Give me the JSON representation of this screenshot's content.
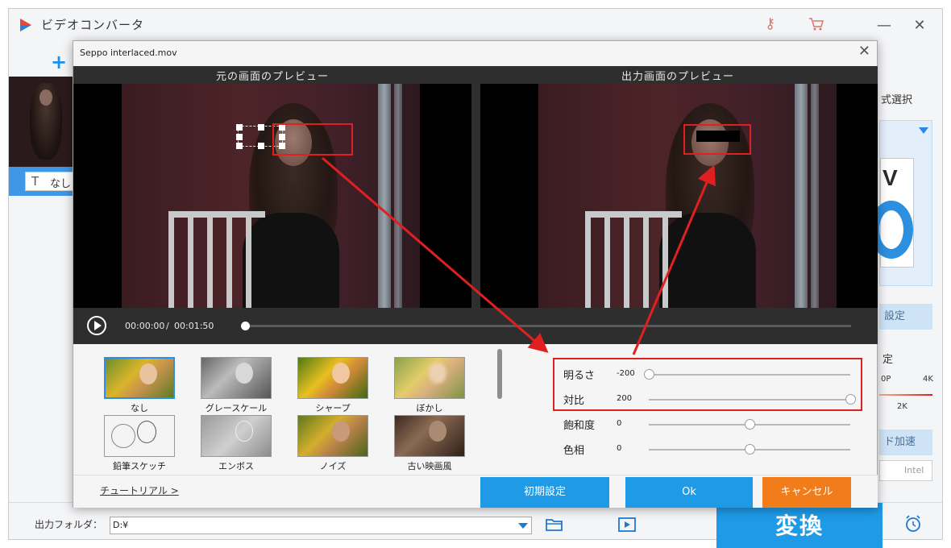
{
  "app": {
    "title": "ビデオコンバータ",
    "close_glyph": "✕",
    "minimize_glyph": "—",
    "key_icon": "key-icon",
    "cart_icon": "cart-icon"
  },
  "left_panel": {
    "add_symbol": "+",
    "subtitle_value": "なし",
    "subtitle_icon_glyph": "T"
  },
  "right_strip": {
    "format_label": "式選択",
    "settings_label": "設定",
    "quality_label": "定",
    "quality_ticks": [
      "0P",
      "4K",
      "2K"
    ],
    "hw_accel_label": "ド加速",
    "intel_label": "Intel"
  },
  "bottom": {
    "output_folder_label": "出力フォルダ：",
    "output_folder_value": "D:¥",
    "convert_label": "変換"
  },
  "dialog": {
    "title": "Seppo interlaced.mov",
    "close_glyph": "✕",
    "original_preview_label": "元の画面のプレビュー",
    "output_preview_label": "出力画面のプレビュー",
    "current_time": "00:00:00",
    "time_separator": "/",
    "total_time": "00:01:50",
    "playback_progress": 0.0,
    "filters": [
      {
        "label": "なし",
        "selected": true
      },
      {
        "label": "グレースケール",
        "selected": false
      },
      {
        "label": "シャープ",
        "selected": false
      },
      {
        "label": "ぼかし",
        "selected": false
      },
      {
        "label": "鉛筆スケッチ",
        "selected": false
      },
      {
        "label": "エンボス",
        "selected": false
      },
      {
        "label": "ノイズ",
        "selected": false
      },
      {
        "label": "古い映画風",
        "selected": false
      }
    ],
    "adjustments": [
      {
        "label": "明るさ",
        "value": "-200",
        "min": -200,
        "max": 200,
        "current": -200
      },
      {
        "label": "対比",
        "value": "200",
        "min": -200,
        "max": 200,
        "current": 200
      },
      {
        "label": "飽和度",
        "value": "0",
        "min": -200,
        "max": 200,
        "current": 0
      },
      {
        "label": "色相",
        "value": "0",
        "min": -200,
        "max": 200,
        "current": 0
      }
    ],
    "tutorial_link": "チュートリアル >",
    "reset_button": "初期設定",
    "ok_button": "Ok",
    "cancel_button": "キャンセル"
  },
  "colors": {
    "accent_blue": "#1f9ae6",
    "cancel_orange": "#f07d1a",
    "annotation_red": "#e02020"
  }
}
